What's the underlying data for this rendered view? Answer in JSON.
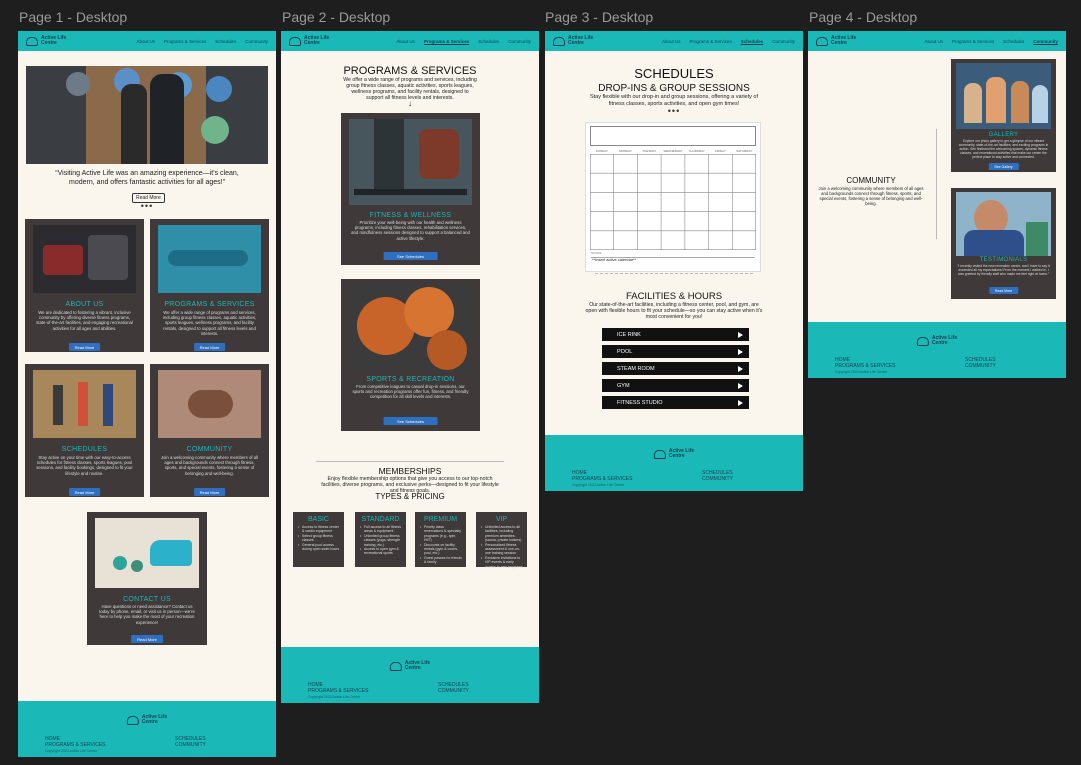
{
  "frames": [
    {
      "label": "Page 1 - Desktop"
    },
    {
      "label": "Page 2 - Desktop"
    },
    {
      "label": "Page 3 - Desktop"
    },
    {
      "label": "Page 4 - Desktop"
    }
  ],
  "logo": {
    "line1": "Active Life",
    "line2": "Centre"
  },
  "nav": {
    "about": "About Us",
    "programs": "Programs & Services",
    "schedules": "Schedules",
    "community": "Community"
  },
  "footer": {
    "home": "HOME",
    "programs": "PROGRAMS & SERVICES",
    "schedules": "SCHEDULES",
    "community": "COMMUNITY",
    "copyright": "Copyright 2024 Active Life Centre"
  },
  "page1": {
    "quote": "“Visiting Active Life was an amazing experience—it’s clean, modern, and offers fantastic activities for all ages!”",
    "read_more": "Read More",
    "dots": "•••",
    "cards": [
      {
        "title": "ABOUT US",
        "text": "We are dedicated to fostering a vibrant, inclusive community by offering diverse fitness programs, state-of-the-art facilities, and engaging recreational activities for all ages and abilities.",
        "button": "Read More"
      },
      {
        "title": "PROGRAMS & SERVICES",
        "text": "We offer a wide range of programs and services, including group fitness classes, aquatic activities, sports leagues, wellness programs, and facility rentals, designed to support all fitness levels and interests.",
        "button": "Read More"
      },
      {
        "title": "SCHEDULES",
        "text": "Stay active on your time with our easy-to-access schedules for fitness classes, sports leagues, pool sessions, and facility bookings, designed to fit your lifestyle and routine.",
        "button": "Read More"
      },
      {
        "title": "COMMUNITY",
        "text": "Join a welcoming community where members of all ages and backgrounds connect through fitness, sports, and special events, fostering a sense of belonging and well-being.",
        "button": "Read More"
      }
    ],
    "contact": {
      "title": "CONTACT US",
      "text": "Have questions or need assistance? Contact us today by phone, email, or visit us in person—we're here to help you make the most of your recreation experience!",
      "button": "Read More"
    }
  },
  "page2": {
    "title": "PROGRAMS & SERVICES",
    "intro": "We offer a wide range of programs and services, including group fitness classes, aquatic activities, sports leagues, wellness programs, and facility rentals, designed to support all fitness levels and interests.",
    "arrow": "↓",
    "fitness": {
      "title": "FITNESS & WELLNESS",
      "text": "Prioritize your well-being with our health and wellness programs, including fitness classes, rehabilitation services, and mindfulness sessions designed to support a balanced and active lifestyle.",
      "button": "See Schedules"
    },
    "sports": {
      "title": "SPORTS & RECREATION",
      "text": "From competitive leagues to casual drop-in sessions, our sports and recreation programs offer fun, fitness, and friendly competition for all skill levels and interests.",
      "button": "See Schedules"
    },
    "memberships": {
      "title": "MEMBERSHIPS",
      "text": "Enjoy flexible membership options that give you access to our top-notch facilities, diverse programs, and exclusive perks—designed to fit your lifestyle and fitness goals.",
      "types": "TYPES & PRICING"
    },
    "tiers": [
      {
        "name": "BASIC",
        "items": [
          "Access to fitness center & cardio equipment",
          "Select group fitness classes",
          "General pool access during open swim hours"
        ]
      },
      {
        "name": "STANDARD",
        "items": [
          "Full access to all fitness areas & equipment",
          "Unlimited group fitness classes (yoga, strength training, etc.)",
          "Access to open gym & recreational sports"
        ]
      },
      {
        "name": "PREMIUM",
        "items": [
          "Priority class reservations & specialty programs (e.g., spin, HIIT)",
          "Discounts on facility rentals (gym & courts, pool, etc.)",
          "Guest passes for friends & family"
        ]
      },
      {
        "name": "VIP",
        "items": [
          "Unlimited access to all facilities, including premium amenities (sauna, private lockers)",
          "Personalized fitness assessment & one-on-one training session",
          "Exclusive invitations to VIP events & early access to new programs"
        ]
      }
    ]
  },
  "page3": {
    "title": "SCHEDULES",
    "subtitle": "DROP-INS & GROUP SESSIONS",
    "intro": "Stay flexible with our drop-in and group sessions, offering a variety of fitness classes, sports activities, and open gym times!",
    "dots": "•••",
    "days": [
      "SUNDAY",
      "MONDAY",
      "TUESDAY",
      "WEDNESDAY",
      "THURSDAY",
      "FRIDAY",
      "SATURDAY"
    ],
    "notes": "NOTES",
    "calendar_note": "**Insert active calendar**",
    "facilities": {
      "title": "FACILITIES & HOURS",
      "text": "Our state-of-the-art facilities, including a fitness center, pool, and gym, are open with flexible hours to fit your schedule—so you can stay active when it's most convenient for you!"
    },
    "items": [
      "ICE RINK",
      "POOL",
      "STEAM ROOM",
      "GYM",
      "FITNESS STUDIO"
    ]
  },
  "page4": {
    "gallery": {
      "title": "GALLERY",
      "text": "Explore our photo gallery to get a glimpse of our vibrant community, state-of-the-art facilities, and exciting programs in action. See firsthand the welcoming spaces, dynamic fitness classes, and recreational activities that make our center the perfect place to stay active and connected.",
      "button": "See Gallery"
    },
    "community": {
      "title": "COMMUNITY",
      "text": "Join a welcoming community where members of all ages and backgrounds connect through fitness, sports, and special events, fostering a sense of belonging and well-being."
    },
    "testimonials": {
      "title": "TESTIMONIALS",
      "text": "“I recently visited the new recreation centre, and I have to say it exceeded all my expectations! From the moment I walked in, I was greeted by friendly staff who made me feel right at home.”",
      "button": "Read More"
    }
  },
  "colors": {
    "teal": "#1ab9b8",
    "card": "#3f393a",
    "cream": "#faf6ee",
    "button": "#2e6fc0"
  }
}
